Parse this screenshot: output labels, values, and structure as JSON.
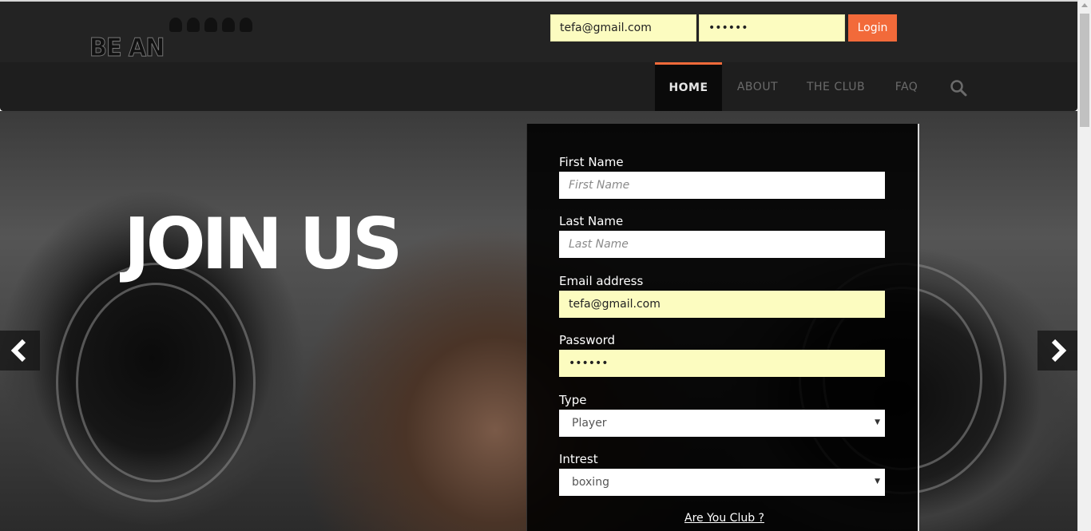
{
  "header": {
    "logo_text": "BE AN OLYMPIC",
    "login": {
      "email_value": "tefa@gmail.com",
      "password_value": "••••••",
      "button_label": "Login"
    }
  },
  "nav": {
    "items": [
      {
        "label": "HOME",
        "active": true
      },
      {
        "label": "ABOUT",
        "active": false
      },
      {
        "label": "THE CLUB",
        "active": false
      },
      {
        "label": "FAQ",
        "active": false
      }
    ],
    "search_icon": "search-icon"
  },
  "hero": {
    "headline": "JOIN US",
    "prev_icon": "chevron-left-icon",
    "next_icon": "chevron-right-icon"
  },
  "form": {
    "first_name": {
      "label": "First Name",
      "placeholder": "First Name"
    },
    "last_name": {
      "label": "Last Name",
      "placeholder": "Last Name"
    },
    "email": {
      "label": "Email address",
      "value": "tefa@gmail.com"
    },
    "password": {
      "label": "Password",
      "value": "••••••"
    },
    "type": {
      "label": "Type",
      "selected": "Player"
    },
    "interest": {
      "label": "Intrest",
      "selected": "boxing"
    },
    "club_link": "Are You Club ?"
  },
  "colors": {
    "accent": "#f26a3a",
    "autofill": "#fcfcc0",
    "topbar": "#232323",
    "navbar": "#1e1e1e"
  }
}
